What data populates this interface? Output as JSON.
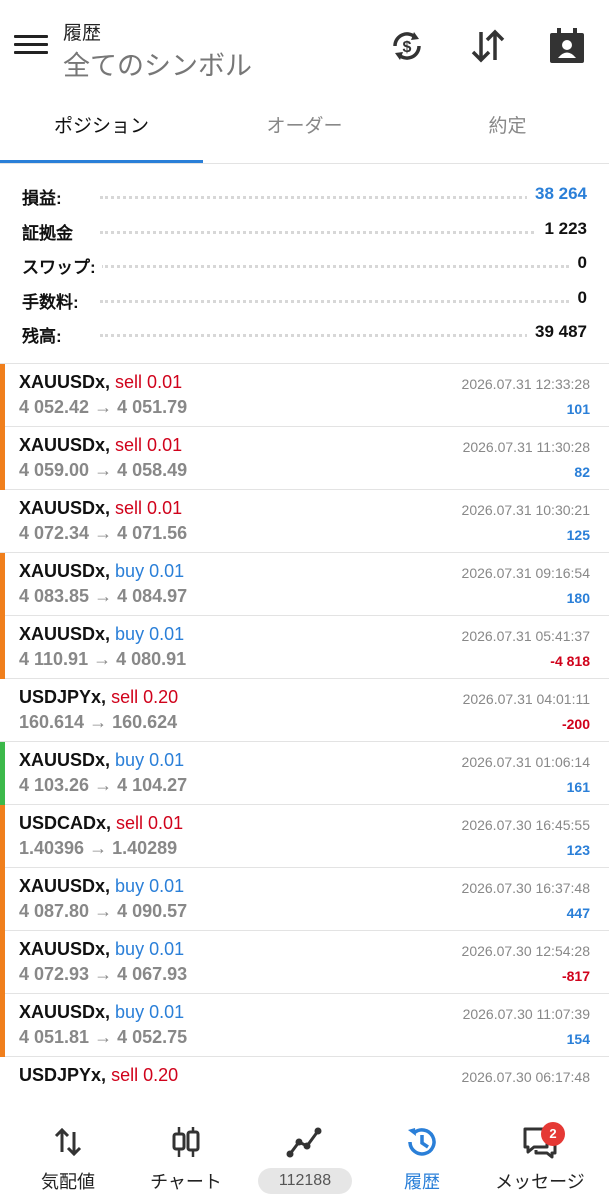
{
  "header": {
    "title": "履歴",
    "subtitle": "全てのシンボル",
    "icons": [
      "menu-icon",
      "currency-refresh-icon",
      "sort-icon",
      "calendar-contact-icon"
    ]
  },
  "tabs": [
    {
      "label": "ポジション",
      "active": true
    },
    {
      "label": "オーダー",
      "active": false
    },
    {
      "label": "約定",
      "active": false
    }
  ],
  "summary": [
    {
      "label": "損益:",
      "value": "38 264",
      "color": "#2a7fd8"
    },
    {
      "label": "証拠金",
      "value": "1 223"
    },
    {
      "label": "スワップ:",
      "value": "0"
    },
    {
      "label": "手数料:",
      "value": "0"
    },
    {
      "label": "残高:",
      "value": "39 487"
    }
  ],
  "positions": [
    {
      "symbol": "XAUUSDx,",
      "side": "sell 0.01",
      "type": "sell",
      "prices": "4 052.42 → 4 051.79",
      "time": "2026.07.31 12:33:28",
      "pnl": "101",
      "pnl_sign": "pos",
      "marker": "#f07f1c"
    },
    {
      "symbol": "XAUUSDx,",
      "side": "sell 0.01",
      "type": "sell",
      "prices": "4 059.00 → 4 058.49",
      "time": "2026.07.31 11:30:28",
      "pnl": "82",
      "pnl_sign": "pos",
      "marker": "#f07f1c"
    },
    {
      "symbol": "XAUUSDx,",
      "side": "sell 0.01",
      "type": "sell",
      "prices": "4 072.34 → 4 071.56",
      "time": "2026.07.31 10:30:21",
      "pnl": "125",
      "pnl_sign": "pos",
      "marker": ""
    },
    {
      "symbol": "XAUUSDx,",
      "side": "buy 0.01",
      "type": "buy",
      "prices": "4 083.85 → 4 084.97",
      "time": "2026.07.31 09:16:54",
      "pnl": "180",
      "pnl_sign": "pos",
      "marker": "#f07f1c"
    },
    {
      "symbol": "XAUUSDx,",
      "side": "buy 0.01",
      "type": "buy",
      "prices": "4 110.91 → 4 080.91",
      "time": "2026.07.31 05:41:37",
      "pnl": "-4 818",
      "pnl_sign": "neg",
      "marker": "#f07f1c"
    },
    {
      "symbol": "USDJPYx,",
      "side": "sell 0.20",
      "type": "sell",
      "prices": "160.614 → 160.624",
      "time": "2026.07.31 04:01:11",
      "pnl": "-200",
      "pnl_sign": "neg",
      "marker": ""
    },
    {
      "symbol": "XAUUSDx,",
      "side": "buy 0.01",
      "type": "buy",
      "prices": "4 103.26 → 4 104.27",
      "time": "2026.07.31 01:06:14",
      "pnl": "161",
      "pnl_sign": "pos",
      "marker": "#3cb94a"
    },
    {
      "symbol": "USDCADx,",
      "side": "sell 0.01",
      "type": "sell",
      "prices": "1.40396 → 1.40289",
      "time": "2026.07.30 16:45:55",
      "pnl": "123",
      "pnl_sign": "pos",
      "marker": "#f07f1c"
    },
    {
      "symbol": "XAUUSDx,",
      "side": "buy 0.01",
      "type": "buy",
      "prices": "4 087.80 → 4 090.57",
      "time": "2026.07.30 16:37:48",
      "pnl": "447",
      "pnl_sign": "pos",
      "marker": "#f07f1c"
    },
    {
      "symbol": "XAUUSDx,",
      "side": "buy 0.01",
      "type": "buy",
      "prices": "4 072.93 → 4 067.93",
      "time": "2026.07.30 12:54:28",
      "pnl": "-817",
      "pnl_sign": "neg",
      "marker": "#f07f1c"
    },
    {
      "symbol": "XAUUSDx,",
      "side": "buy 0.01",
      "type": "buy",
      "prices": "4 051.81 → 4 052.75",
      "time": "2026.07.30 11:07:39",
      "pnl": "154",
      "pnl_sign": "pos",
      "marker": "#f07f1c"
    },
    {
      "symbol": "USDJPYx,",
      "side": "sell 0.20",
      "type": "sell",
      "prices": "",
      "time": "2026.07.30 06:17:48",
      "pnl": "",
      "pnl_sign": "neg",
      "marker": ""
    }
  ],
  "bottom_nav": [
    {
      "label": "気配値",
      "icon": "quotes-icon",
      "active": false
    },
    {
      "label": "チャート",
      "icon": "chart-icon",
      "active": false
    },
    {
      "label": "",
      "icon": "trade-icon",
      "active": false
    },
    {
      "label": "履歴",
      "icon": "history-icon",
      "active": true
    },
    {
      "label": "メッセージ",
      "icon": "messages-icon",
      "active": false
    }
  ],
  "connection_label": "112188",
  "messages_badge": "2",
  "colors": {
    "accent": "#2a7fd8",
    "sell": "#d0021b",
    "loss": "#d0021b",
    "marker_orange": "#f07f1c",
    "marker_green": "#3cb94a"
  }
}
